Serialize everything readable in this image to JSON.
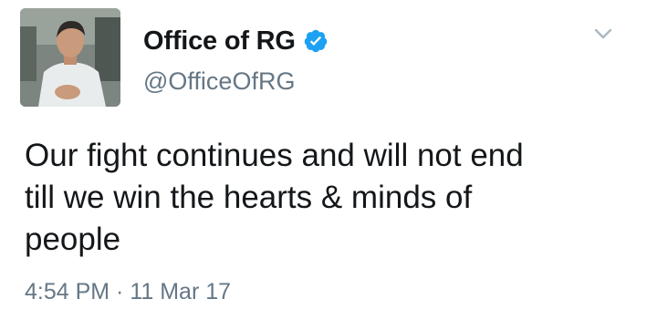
{
  "tweet": {
    "display_name": "Office of RG",
    "handle": "@OfficeOfRG",
    "verified": true,
    "text_lines": [
      "Our fight continues and will not end",
      "till we win the hearts & minds of",
      "people"
    ],
    "timestamp": "4:54 PM · 11 Mar 17"
  },
  "icons": {
    "verified": "verified-badge-icon",
    "caret": "chevron-down-icon"
  },
  "colors": {
    "verified_blue": "#1da1f2",
    "secondary_text": "#657786",
    "primary_text": "#14171a"
  }
}
